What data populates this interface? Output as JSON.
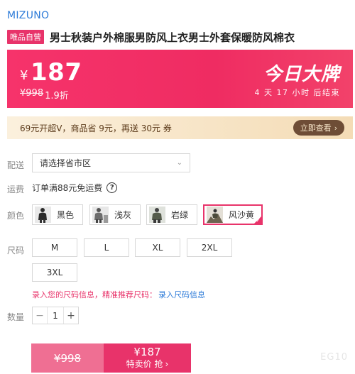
{
  "brand": "MIZUNO",
  "product": {
    "tag": "唯品自营",
    "title": "男士秋装户外棉服男防风上衣男士外套保暖防风棉衣"
  },
  "price_banner": {
    "currency": "¥",
    "price": "187",
    "original_price": "¥998",
    "discount": "1.9折",
    "deal_title": "今日大牌",
    "countdown": "4 天 17 小时 后结束"
  },
  "promo": {
    "text": "69元开超V，商品省 9元，再送 30元 券",
    "button_label": "立即查看",
    "button_chevron": "›"
  },
  "delivery": {
    "label": "配送",
    "region_placeholder": "请选择省市区",
    "chevron": "⌄"
  },
  "shipping": {
    "label": "运费",
    "text": "订单满88元免运费",
    "help": "?"
  },
  "colors": {
    "label": "颜色",
    "options": [
      {
        "name": "黑色",
        "thumb_color": "#e9e9e9",
        "figure_color": "#2a2a2a"
      },
      {
        "name": "浅灰",
        "thumb_color": "#e7e7e7",
        "figure_color": "#6d6d6d"
      },
      {
        "name": "岩绿",
        "thumb_color": "#dfe2dc",
        "figure_color": "#555c4c"
      },
      {
        "name": "风沙黄",
        "thumb_color": "#e3dfd6",
        "figure_color": "#6c6450"
      }
    ],
    "selected": "风沙黄"
  },
  "sizes": {
    "label": "尺码",
    "options": [
      "M",
      "L",
      "XL",
      "2XL",
      "3XL"
    ]
  },
  "size_recommend": {
    "text": "录入您的尺码信息，精准推荐尺码：",
    "link": "录入尺码信息"
  },
  "quantity": {
    "label": "数量",
    "minus": "−",
    "value": "1",
    "plus": "+"
  },
  "buy": {
    "original": "¥998",
    "price": "¥187",
    "action": "特卖价 抢",
    "chevron": "›"
  },
  "watermark": "EG10",
  "colors_theme": {
    "accent": "#e8336a",
    "link": "#2d7bd8",
    "promo_btn": "#6e4d36"
  }
}
